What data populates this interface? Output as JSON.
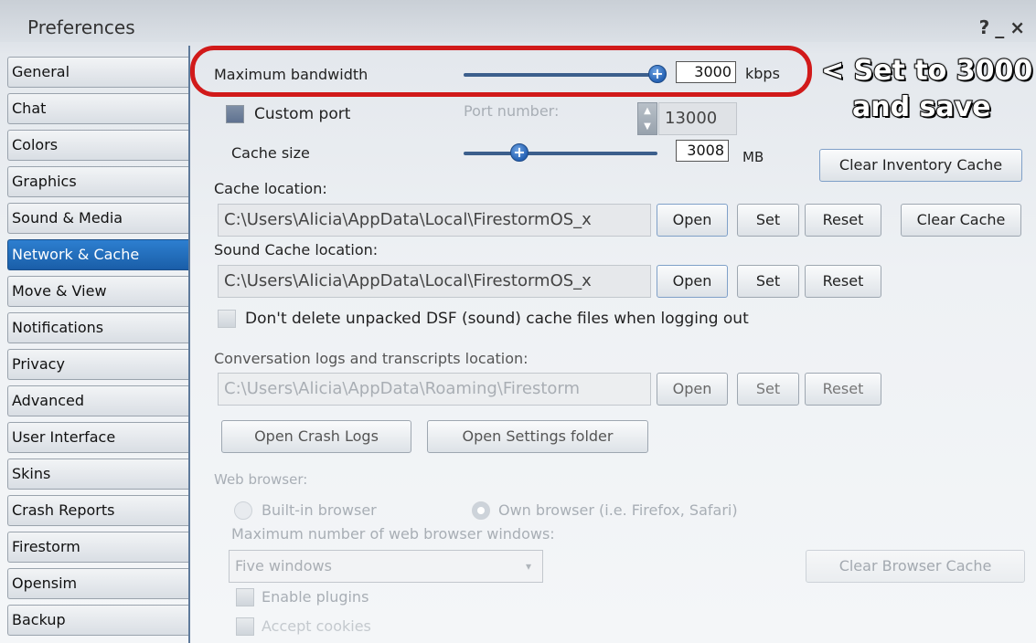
{
  "window": {
    "title": "Preferences",
    "help": "?",
    "minimize": "_",
    "close": "×"
  },
  "sidebar": {
    "items": [
      {
        "label": "General"
      },
      {
        "label": "Chat"
      },
      {
        "label": "Colors"
      },
      {
        "label": "Graphics"
      },
      {
        "label": "Sound & Media"
      },
      {
        "label": "Network & Cache",
        "active": true
      },
      {
        "label": "Move & View"
      },
      {
        "label": "Notifications"
      },
      {
        "label": "Privacy"
      },
      {
        "label": "Advanced"
      },
      {
        "label": "User Interface"
      },
      {
        "label": "Skins"
      },
      {
        "label": "Crash Reports"
      },
      {
        "label": "Firestorm"
      },
      {
        "label": "Opensim"
      },
      {
        "label": "Backup"
      }
    ]
  },
  "network": {
    "bandwidth_label": "Maximum bandwidth",
    "bandwidth_value": "3000",
    "bandwidth_unit": "kbps",
    "custom_port_label": "Custom port",
    "port_number_label": "Port number:",
    "port_value": "13000",
    "cache_size_label": "Cache size",
    "cache_size_value": "3008",
    "cache_size_unit": "MB",
    "clear_inventory_cache": "Clear Inventory Cache"
  },
  "cache": {
    "location_label": "Cache location:",
    "location_value": "C:\\Users\\Alicia\\AppData\\Local\\FirestormOS_x",
    "open": "Open",
    "set": "Set",
    "reset": "Reset",
    "clear_cache": "Clear Cache",
    "sound_location_label": "Sound Cache location:",
    "sound_location_value": "C:\\Users\\Alicia\\AppData\\Local\\FirestormOS_x",
    "dsf_checkbox_label": "Don't delete unpacked DSF (sound) cache files when logging out"
  },
  "logs": {
    "location_label": "Conversation logs and transcripts location:",
    "location_value": "C:\\Users\\Alicia\\AppData\\Roaming\\Firestorm",
    "open": "Open",
    "set": "Set",
    "reset": "Reset",
    "open_crash_logs": "Open Crash Logs",
    "open_settings_folder": "Open Settings folder"
  },
  "browser": {
    "label": "Web browser:",
    "builtin": "Built-in browser",
    "own": "Own browser (i.e. Firefox, Safari)",
    "max_windows_label": "Maximum number of web browser windows:",
    "max_windows_value": "Five windows",
    "clear_browser_cache": "Clear Browser Cache",
    "enable_plugins": "Enable plugins",
    "accept_cookies": "Accept cookies"
  },
  "annotation": {
    "line1": "< Set to 3000",
    "line2": "and save",
    "color": "#d11a1a"
  }
}
